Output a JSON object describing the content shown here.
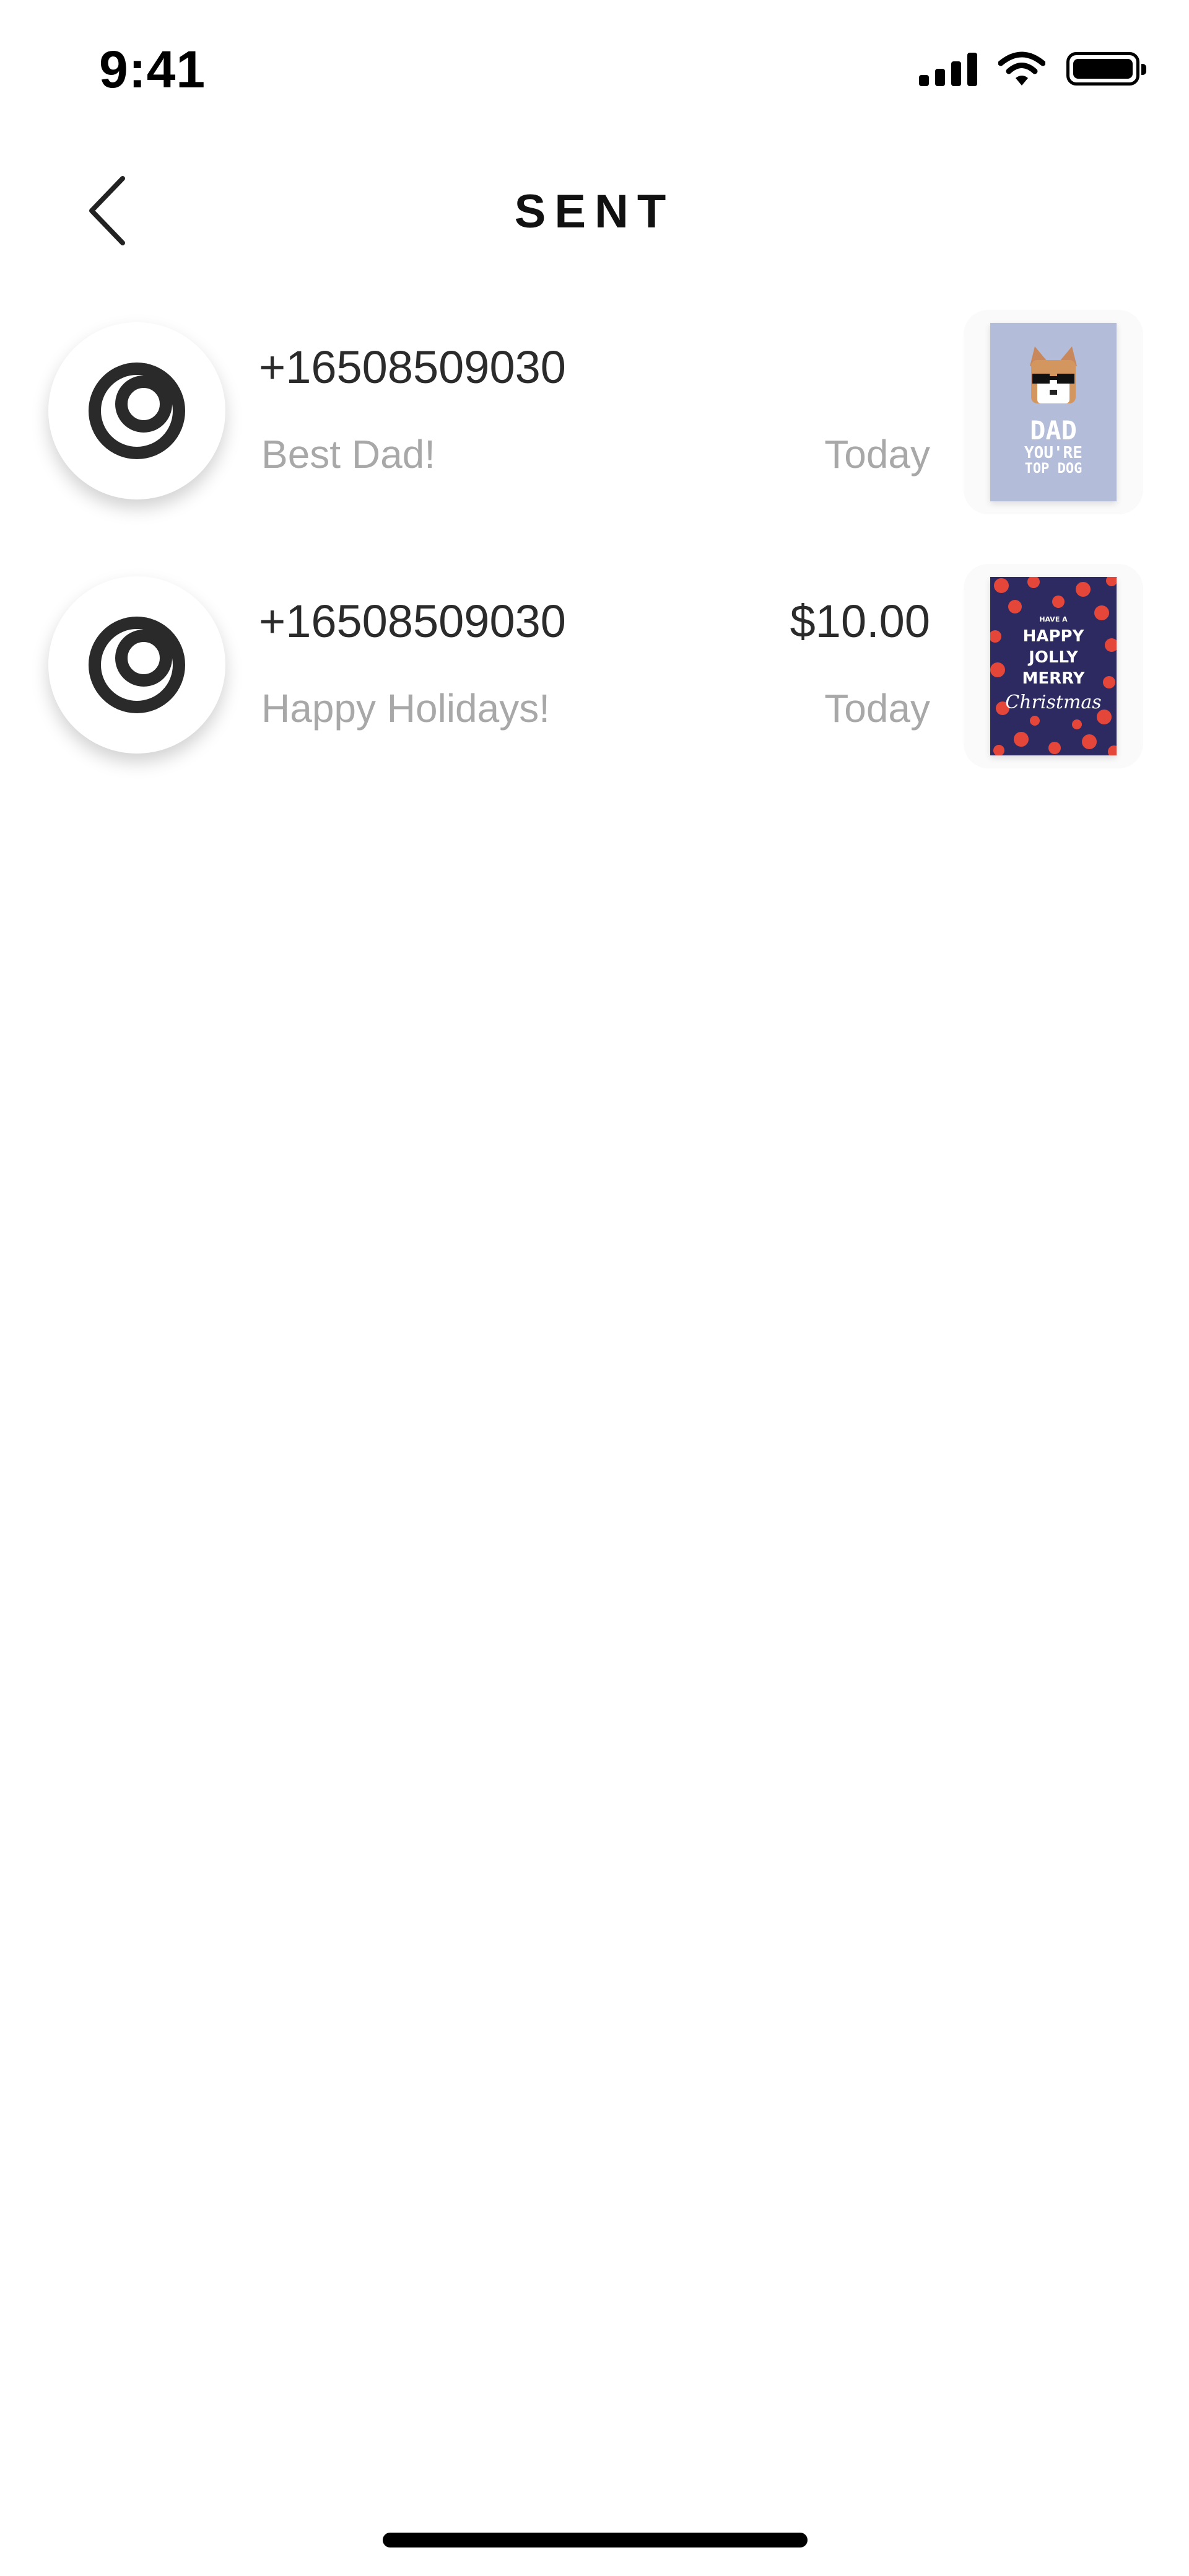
{
  "status_bar": {
    "time": "9:41"
  },
  "header": {
    "title": "SENT"
  },
  "items": [
    {
      "phone": "+16508509030",
      "amount": "",
      "message": "Best Dad!",
      "date": "Today",
      "card": {
        "lines": [
          "DAD",
          "YOU'RE",
          "TOP DOG"
        ],
        "background": "#b3bcd9"
      }
    },
    {
      "phone": "+16508509030",
      "amount": "$10.00",
      "message": "Happy Holidays!",
      "date": "Today",
      "card": {
        "lines": [
          "HAVE A",
          "HAPPY",
          "JOLLY",
          "MERRY",
          "Christmas"
        ],
        "background": "#2c2a60",
        "dots": "#e5463a"
      }
    }
  ]
}
